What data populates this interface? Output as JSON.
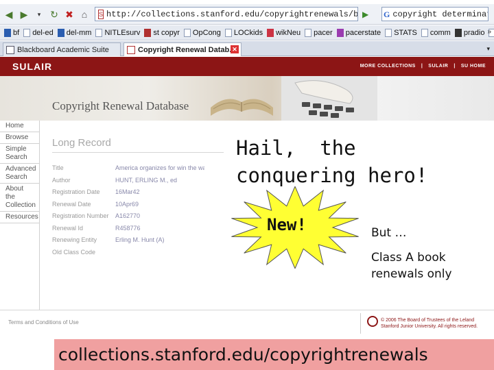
{
  "browser": {
    "url": "http://collections.stanford.edu/copyrightrenewals/bin/search/advanced/process?clau",
    "search_value": "copyright determinator",
    "bookmarks": [
      {
        "label": "bf",
        "color": "#2a5db0"
      },
      {
        "label": "del-ed",
        "color": ""
      },
      {
        "label": "del-mm",
        "color": "#2a5db0"
      },
      {
        "label": "NITLEsurv",
        "color": ""
      },
      {
        "label": "st copyr",
        "color": "#b03030"
      },
      {
        "label": "OpCong",
        "color": ""
      },
      {
        "label": "LOCkids",
        "color": ""
      },
      {
        "label": "wikNeu",
        "color": "#cc3344"
      },
      {
        "label": "pacer",
        "color": ""
      },
      {
        "label": "pacerstate",
        "color": "#9b3cb0"
      },
      {
        "label": "STATS",
        "color": ""
      },
      {
        "label": "comm",
        "color": ""
      },
      {
        "label": "pradio",
        "color": "#333333"
      },
      {
        "label": "sccl",
        "color": ""
      }
    ],
    "bookmarks_more": "»",
    "tabs": [
      {
        "label": "Blackboard Academic Suite"
      },
      {
        "label": "Copyright Renewal Datab..."
      }
    ]
  },
  "site": {
    "logo": "SULAIR",
    "header_links": [
      "MORE COLLECTIONS",
      "|",
      "SULAIR",
      "|",
      "SU HOME"
    ],
    "banner_title": "Copyright Renewal Database",
    "sidebar": [
      "Home",
      "Browse",
      "Simple Search",
      "Advanced Search",
      "About the Collection",
      "Resources"
    ],
    "record_heading": "Long Record",
    "record": [
      {
        "label": "Title",
        "value": "America organizes for win the war"
      },
      {
        "label": "Author",
        "value": "HUNT, ERLING M., ed"
      },
      {
        "label": "Registration Date",
        "value": "16Mar42"
      },
      {
        "label": "Renewal Date",
        "value": "10Apr69"
      },
      {
        "label": "Registration Number",
        "value": "A162770"
      },
      {
        "label": "Renewal Id",
        "value": "R458776"
      },
      {
        "label": "Renewing Entity",
        "value": "Erling M. Hunt (A)"
      },
      {
        "label": "Old Class Code",
        "value": ""
      }
    ],
    "footer_terms": "Terms and Conditions of Use",
    "footer_copyright": "© 2006 The Board of Trustees of the Leland Stanford Junior University. All rights reserved."
  },
  "overlay": {
    "title": "Hail,  the\nconquering hero!",
    "burst_label": "New!",
    "burst_color": "#ffff33",
    "note_but": "But …",
    "note_class": "Class A book renewals only",
    "url_caption": "collections.stanford.edu/copyrightrenewals",
    "caption_color": "#f0a0a0"
  },
  "colors": {
    "stanford_red": "#8c1515"
  }
}
